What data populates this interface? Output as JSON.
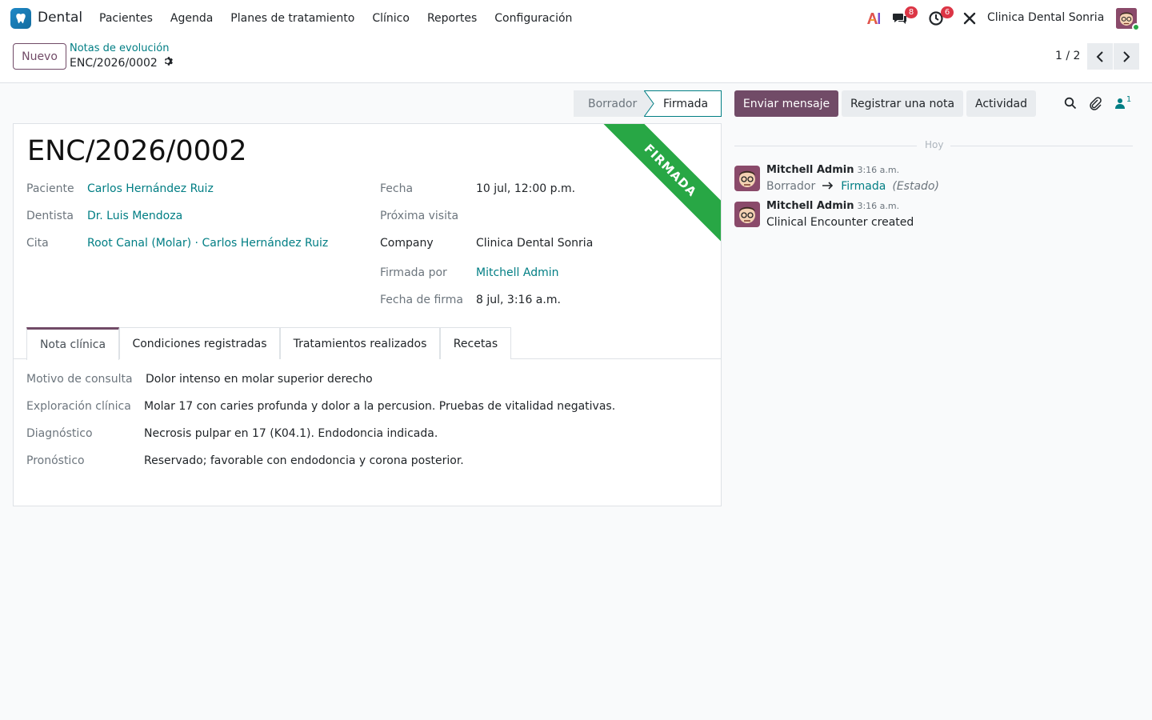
{
  "navbar": {
    "app_name": "Dental",
    "menu": [
      "Pacientes",
      "Agenda",
      "Planes de tratamiento",
      "Clínico",
      "Reportes",
      "Configuración"
    ],
    "messages_badge": "8",
    "activities_badge": "6",
    "company": "Clinica Dental Sonria"
  },
  "control": {
    "new_label": "Nuevo",
    "breadcrumb_parent": "Notas de evolución",
    "breadcrumb_current": "ENC/2026/0002",
    "pager": "1 / 2"
  },
  "statusbar": {
    "stages": [
      "Borrador",
      "Firmada"
    ],
    "current": "Firmada"
  },
  "record": {
    "title": "ENC/2026/0002",
    "ribbon": "FIRMADA",
    "left_fields": [
      {
        "label": "Paciente",
        "value": "Carlos Hernández Ruiz"
      },
      {
        "label": "Dentista",
        "value": "Dr. Luis Mendoza"
      },
      {
        "label": "Cita",
        "value": "Root Canal (Molar) · Carlos Hernández Ruiz"
      }
    ],
    "right_fields": [
      {
        "label": "Fecha",
        "value": "10 jul, 12:00 p.m."
      },
      {
        "label": "Próxima visita",
        "value": ""
      },
      {
        "label": "Company",
        "value": "Clinica Dental Sonria"
      },
      {
        "label": "Firmada por",
        "value": "Mitchell Admin"
      },
      {
        "label": "Fecha de firma",
        "value": "8 jul, 3:16 a.m."
      }
    ],
    "tabs": [
      "Nota clínica",
      "Condiciones registradas",
      "Tratamientos realizados",
      "Recetas"
    ],
    "active_tab": "Nota clínica",
    "note_fields": [
      {
        "label": "Motivo de consulta",
        "value": "Dolor intenso en molar superior derecho"
      },
      {
        "label": "Exploración clínica",
        "value": "Molar 17 con caries profunda y dolor a la percusion. Pruebas de vitalidad negativas."
      },
      {
        "label": "Diagnóstico",
        "value": "Necrosis pulpar en 17 (K04.1). Endodoncia indicada."
      },
      {
        "label": "Pronóstico",
        "value": "Reservado; favorable con endodoncia y corona posterior."
      }
    ]
  },
  "chatter": {
    "send_message": "Enviar mensaje",
    "log_note": "Registrar una nota",
    "activity": "Actividad",
    "followers_count": "1",
    "separator": "Hoy",
    "messages": [
      {
        "author": "Mitchell Admin",
        "time": "3:16 a.m.",
        "tracking_from": "Borrador",
        "tracking_to": "Firmada",
        "tracking_field": "(Estado)"
      },
      {
        "author": "Mitchell Admin",
        "time": "3:16 a.m.",
        "body": "Clinical Encounter created"
      }
    ]
  },
  "colors": {
    "brand": "#714b67",
    "link": "#017e84",
    "ribbon": "#28a745",
    "badge": "#dc3545"
  }
}
